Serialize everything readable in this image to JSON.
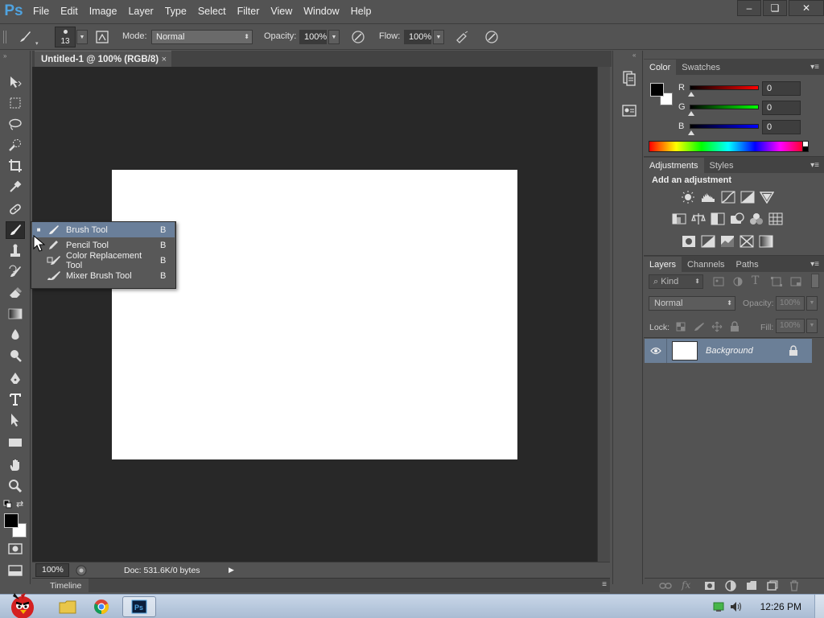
{
  "app": {
    "logo": "Ps",
    "menu": [
      "File",
      "Edit",
      "Image",
      "Layer",
      "Type",
      "Select",
      "Filter",
      "View",
      "Window",
      "Help"
    ]
  },
  "window_controls": {
    "minimize": "–",
    "restore": "❏",
    "close": "✕"
  },
  "options_bar": {
    "brush_size": "13",
    "mode_label": "Mode:",
    "mode_value": "Normal",
    "opacity_label": "Opacity:",
    "opacity_value": "100%",
    "flow_label": "Flow:",
    "flow_value": "100%"
  },
  "document": {
    "tab_title": "Untitled-1 @ 100% (RGB/8)",
    "tab_close": "×",
    "zoom": "100%",
    "doc_info": "Doc: 531.6K/0 bytes",
    "timeline_label": "Timeline"
  },
  "flyout": {
    "items": [
      {
        "label": "Brush Tool",
        "key": "B",
        "selected": true,
        "icon": "brush-icon"
      },
      {
        "label": "Pencil Tool",
        "key": "B",
        "selected": false,
        "icon": "pencil-icon"
      },
      {
        "label": "Color Replacement Tool",
        "key": "B",
        "selected": false,
        "icon": "color-replacement-icon"
      },
      {
        "label": "Mixer Brush Tool",
        "key": "B",
        "selected": false,
        "icon": "mixer-brush-icon"
      }
    ]
  },
  "color_panel": {
    "tabs": [
      "Color",
      "Swatches"
    ],
    "r_label": "R",
    "r_value": "0",
    "g_label": "G",
    "g_value": "0",
    "b_label": "B",
    "b_value": "0"
  },
  "adjustments_panel": {
    "tabs": [
      "Adjustments",
      "Styles"
    ],
    "heading": "Add an adjustment"
  },
  "layers_panel": {
    "tabs": [
      "Layers",
      "Channels",
      "Paths"
    ],
    "kind_label": "Kind",
    "blend_mode": "Normal",
    "opacity_label": "Opacity:",
    "opacity_value": "100%",
    "lock_label": "Lock:",
    "fill_label": "Fill:",
    "fill_value": "100%",
    "layers": [
      {
        "name": "Background"
      }
    ]
  },
  "taskbar": {
    "clock": "12:26 PM"
  },
  "colors": {
    "accent": "#6b7f97",
    "canvas_bg": "#282828",
    "panel_bg": "#535353"
  }
}
